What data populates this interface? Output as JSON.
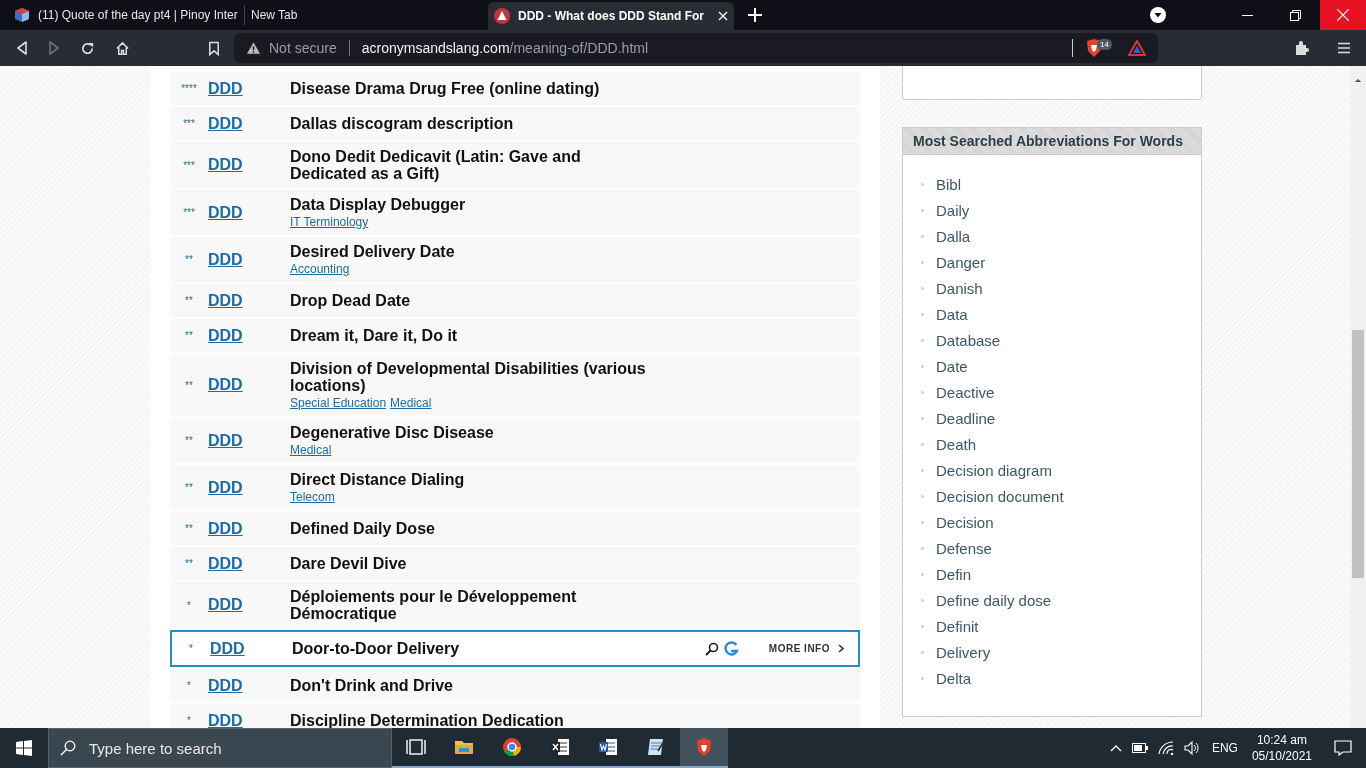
{
  "browser": {
    "tabs": [
      {
        "title": "(11) Quote of the day pt4 | Pinoy Inter",
        "kind": "cube",
        "selected": false
      },
      {
        "title": "New Tab",
        "kind": "none",
        "selected": false
      },
      {
        "title": "DDD - What does DDD Stand For",
        "kind": "site",
        "selected": true
      }
    ],
    "address": {
      "security": "Not secure",
      "domain": "acronymsandslang.com",
      "path": "/meaning-of/DDD.html"
    },
    "shield_count": "14"
  },
  "results": [
    {
      "rank": "****",
      "term": "DDD",
      "meaning": "Disease Drama Drug Free (online dating)",
      "selected": false
    },
    {
      "rank": "***",
      "term": "DDD",
      "meaning": "Dallas discogram description",
      "selected": false
    },
    {
      "rank": "***",
      "term": "DDD",
      "meaning": "Dono Dedit Dedicavit (Latin: Gave and Dedicated as a Gift)",
      "selected": false
    },
    {
      "rank": "***",
      "term": "DDD",
      "meaning": "Data Display Debugger",
      "categories": [
        "IT Terminology"
      ],
      "selected": false
    },
    {
      "rank": "**",
      "term": "DDD",
      "meaning": "Desired Delivery Date",
      "categories": [
        "Accounting"
      ],
      "selected": false
    },
    {
      "rank": "**",
      "term": "DDD",
      "meaning": "Drop Dead Date",
      "selected": false
    },
    {
      "rank": "**",
      "term": "DDD",
      "meaning": "Dream it, Dare it, Do it",
      "selected": false
    },
    {
      "rank": "**",
      "term": "DDD",
      "meaning": "Division of Developmental Disabilities (various locations)",
      "categories": [
        "Special Education",
        "Medical"
      ],
      "selected": false
    },
    {
      "rank": "**",
      "term": "DDD",
      "meaning": "Degenerative Disc Disease",
      "categories": [
        "Medical"
      ],
      "selected": false
    },
    {
      "rank": "**",
      "term": "DDD",
      "meaning": "Direct Distance Dialing",
      "categories": [
        "Telecom"
      ],
      "selected": false
    },
    {
      "rank": "**",
      "term": "DDD",
      "meaning": "Defined Daily Dose",
      "selected": false
    },
    {
      "rank": "**",
      "term": "DDD",
      "meaning": "Dare Devil Dive",
      "selected": false
    },
    {
      "rank": "*",
      "term": "DDD",
      "meaning": "Déploiements pour le Développement Démocratique",
      "selected": false
    },
    {
      "rank": "*",
      "term": "DDD",
      "meaning": "Door-to-Door Delivery",
      "more_info": "MORE INFO",
      "selected": true
    },
    {
      "rank": "*",
      "term": "DDD",
      "meaning": "Don't Drink and Drive",
      "selected": false
    },
    {
      "rank": "*",
      "term": "DDD",
      "meaning": "Discipline Determination Dedication",
      "selected": false
    }
  ],
  "sidebar": {
    "title": "Most Searched Abbreviations For Words",
    "items": [
      "Bibl",
      "Daily",
      "Dalla",
      "Danger",
      "Danish",
      "Data",
      "Database",
      "Date",
      "Deactive",
      "Deadline",
      "Death",
      "Decision diagram",
      "Decision document",
      "Decision",
      "Defense",
      "Defin",
      "Define daily dose",
      "Definit",
      "Delivery",
      "Delta"
    ]
  },
  "taskbar": {
    "search_placeholder": "Type here to search",
    "apps": [
      {
        "kind": "taskview",
        "selected": false
      },
      {
        "kind": "folder",
        "selected": false
      },
      {
        "kind": "chrome",
        "selected": false
      },
      {
        "kind": "excel",
        "selected": false
      },
      {
        "kind": "word",
        "selected": false
      },
      {
        "kind": "notepad",
        "selected": false
      },
      {
        "kind": "brave",
        "selected": true
      }
    ],
    "language": "ENG",
    "time": "10:24 am",
    "date": "05/10/2021"
  }
}
